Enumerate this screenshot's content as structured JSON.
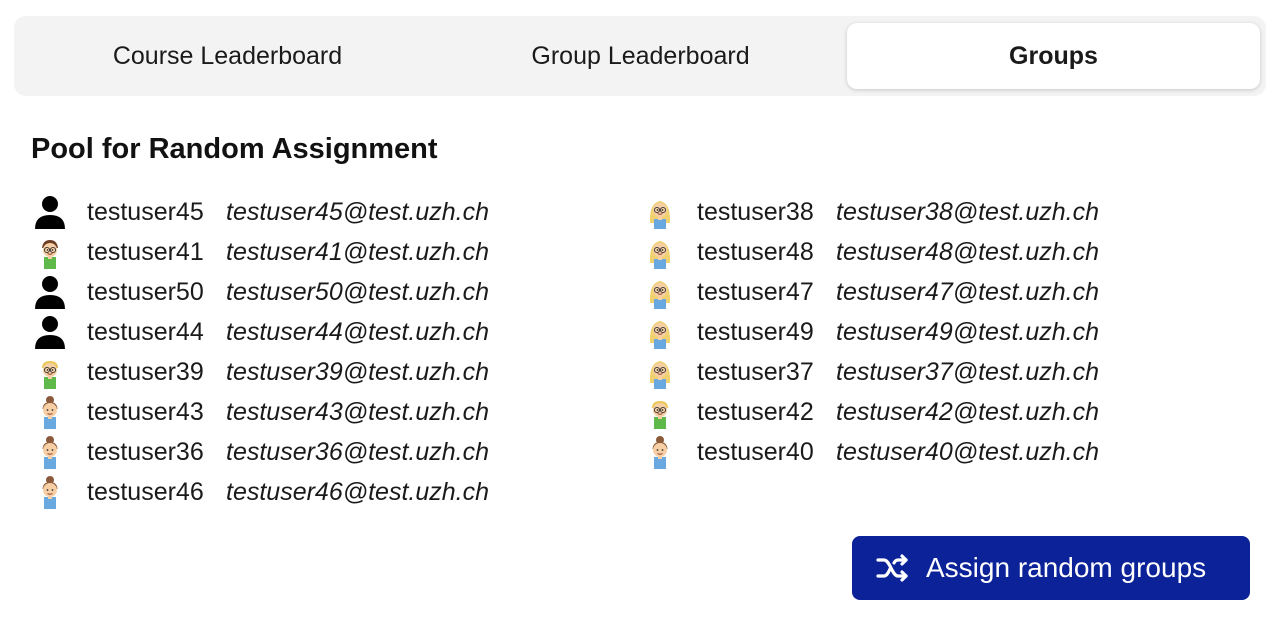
{
  "tabs": [
    {
      "label": "Course Leaderboard",
      "active": false
    },
    {
      "label": "Group Leaderboard",
      "active": false
    },
    {
      "label": "Groups",
      "active": true
    }
  ],
  "pool": {
    "heading": "Pool for Random Assignment",
    "left": [
      {
        "user": "testuser45",
        "email": "testuser45@test.uzh.ch",
        "avatar": "person-icon"
      },
      {
        "user": "testuser41",
        "email": "testuser41@test.uzh.ch",
        "avatar": "avatar-boy-glasses-icon"
      },
      {
        "user": "testuser50",
        "email": "testuser50@test.uzh.ch",
        "avatar": "person-icon"
      },
      {
        "user": "testuser44",
        "email": "testuser44@test.uzh.ch",
        "avatar": "person-icon"
      },
      {
        "user": "testuser39",
        "email": "testuser39@test.uzh.ch",
        "avatar": "avatar-blond-glasses-icon"
      },
      {
        "user": "testuser43",
        "email": "testuser43@test.uzh.ch",
        "avatar": "avatar-bun-icon"
      },
      {
        "user": "testuser36",
        "email": "testuser36@test.uzh.ch",
        "avatar": "avatar-bun-icon"
      },
      {
        "user": "testuser46",
        "email": "testuser46@test.uzh.ch",
        "avatar": "avatar-bun-icon"
      }
    ],
    "right": [
      {
        "user": "testuser38",
        "email": "testuser38@test.uzh.ch",
        "avatar": "avatar-blonde-long-icon"
      },
      {
        "user": "testuser48",
        "email": "testuser48@test.uzh.ch",
        "avatar": "avatar-blonde-long-icon"
      },
      {
        "user": "testuser47",
        "email": "testuser47@test.uzh.ch",
        "avatar": "avatar-blonde-long-icon"
      },
      {
        "user": "testuser49",
        "email": "testuser49@test.uzh.ch",
        "avatar": "avatar-blonde-long-icon"
      },
      {
        "user": "testuser37",
        "email": "testuser37@test.uzh.ch",
        "avatar": "avatar-blonde-long-icon"
      },
      {
        "user": "testuser42",
        "email": "testuser42@test.uzh.ch",
        "avatar": "avatar-blond-glasses-icon"
      },
      {
        "user": "testuser40",
        "email": "testuser40@test.uzh.ch",
        "avatar": "avatar-bun-icon"
      }
    ]
  },
  "assign_button": {
    "label": "Assign random groups",
    "icon": "shuffle-icon"
  },
  "colors": {
    "primary": "#0b2299",
    "tab_bg": "#f3f3f3"
  }
}
